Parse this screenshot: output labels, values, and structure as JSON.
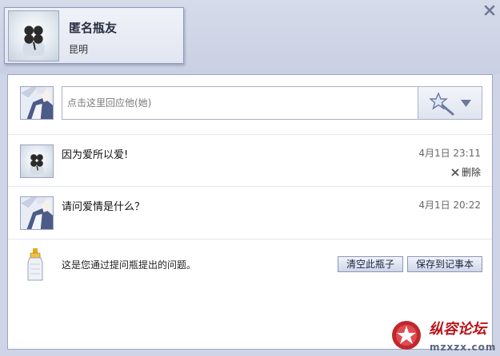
{
  "profile": {
    "name": "匿名瓶友",
    "city": "昆明"
  },
  "reply": {
    "placeholder": "点击这里回应他(她)"
  },
  "messages": [
    {
      "text": "因为爱所以爱!",
      "time": "4月1日 23:11",
      "delete_label": "删除"
    },
    {
      "text": "请问爱情是什么？",
      "time": "4月1日 20:22"
    }
  ],
  "footer": {
    "note": "这是您通过提问瓶提出的问题。",
    "clear_label": "清空此瓶子",
    "save_label": "保存到记事本"
  },
  "watermark": {
    "title": "纵容论坛",
    "url": "mzxzx.com"
  },
  "icons": {
    "close": "close-icon",
    "emote": "magic-wand-icon",
    "dropdown": "chevron-down-icon",
    "delete": "x-icon",
    "bottle": "bottle-icon"
  },
  "colors": {
    "header_bg": "#cfd5e6",
    "panel_border": "#9ba6c4",
    "button_border": "#8a97ba",
    "watermark_red": "#b8151b"
  }
}
